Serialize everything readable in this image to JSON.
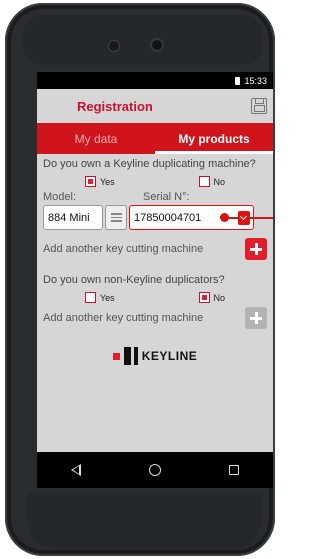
{
  "status_bar": {
    "time": "15:33"
  },
  "app_bar": {
    "title": "Registration"
  },
  "tabs": [
    {
      "label": "My data",
      "active": false
    },
    {
      "label": "My products",
      "active": true
    }
  ],
  "keyline_section": {
    "question": "Do you own a Keyline duplicating machine?",
    "yes_label": "Yes",
    "yes_checked": true,
    "no_label": "No",
    "no_checked": false
  },
  "machine": {
    "model_label": "Model:",
    "model_value": "884 Mini",
    "serial_label": "Serial N°:",
    "serial_value": "17850004701"
  },
  "add_keyline": {
    "label": "Add another key cutting machine",
    "enabled": true
  },
  "non_keyline_section": {
    "question": "Do you own non-Keyline duplicators?",
    "yes_label": "Yes",
    "yes_checked": false,
    "no_label": "No",
    "no_checked": true
  },
  "add_other": {
    "label": "Add another key cutting machine",
    "enabled": false
  },
  "brand": {
    "name": "KEYLINE"
  },
  "colors": {
    "accent": "#d0141b",
    "checkbox": "#e31d2a",
    "background": "#d6d6d6"
  }
}
